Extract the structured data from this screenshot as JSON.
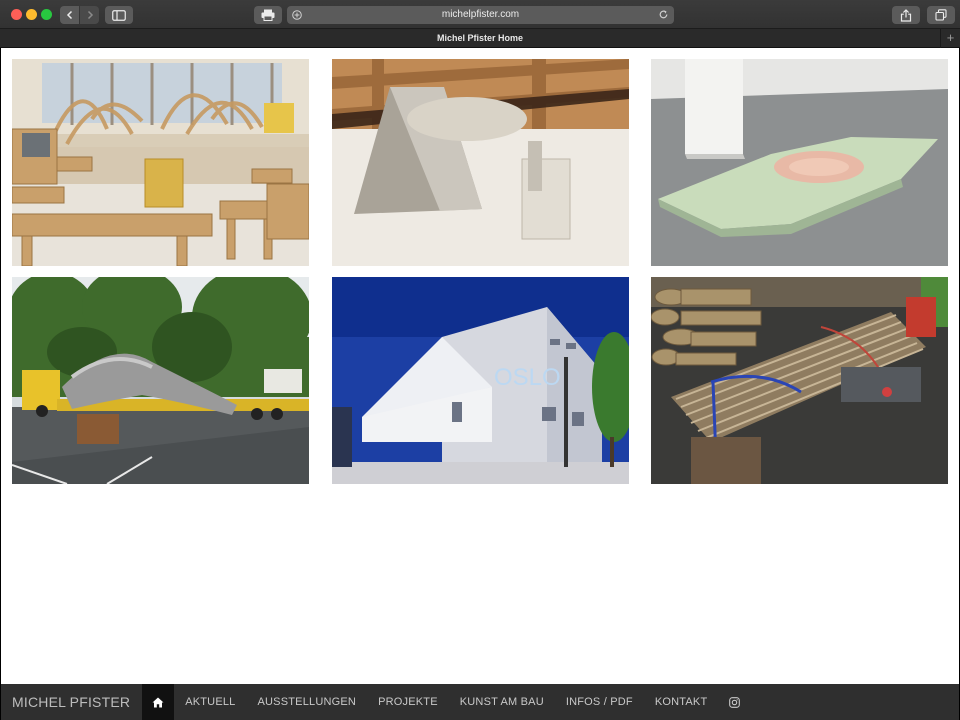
{
  "browser": {
    "url": "michelpfister.com",
    "tab_title": "Michel Pfister Home",
    "tab_add": "+"
  },
  "gallery": {
    "images": [
      {
        "subject": "atelier with wooden benches and sculpture"
      },
      {
        "subject": "metal funnel sculpture under wooden beams"
      },
      {
        "subject": "wavy foam relief lying on concrete floor"
      },
      {
        "subject": "large tube sculpture transported on a truck"
      },
      {
        "subject": "white building with OSLO lettering at dusk"
      },
      {
        "subject": "bundled wooden planks on a trailer"
      }
    ],
    "oslo_sign": "OSLO"
  },
  "nav": {
    "brand": "MICHEL PFISTER",
    "items": [
      "AKTUELL",
      "AUSSTELLUNGEN",
      "PROJEKTE",
      "KUNST AM BAU",
      "INFOS / PDF",
      "KONTAKT"
    ]
  },
  "icons": [
    "home-icon",
    "instagram-icon",
    "back-icon",
    "forward-icon",
    "sidebar-icon",
    "print-icon",
    "reload-icon",
    "share-icon",
    "tabs-icon"
  ]
}
